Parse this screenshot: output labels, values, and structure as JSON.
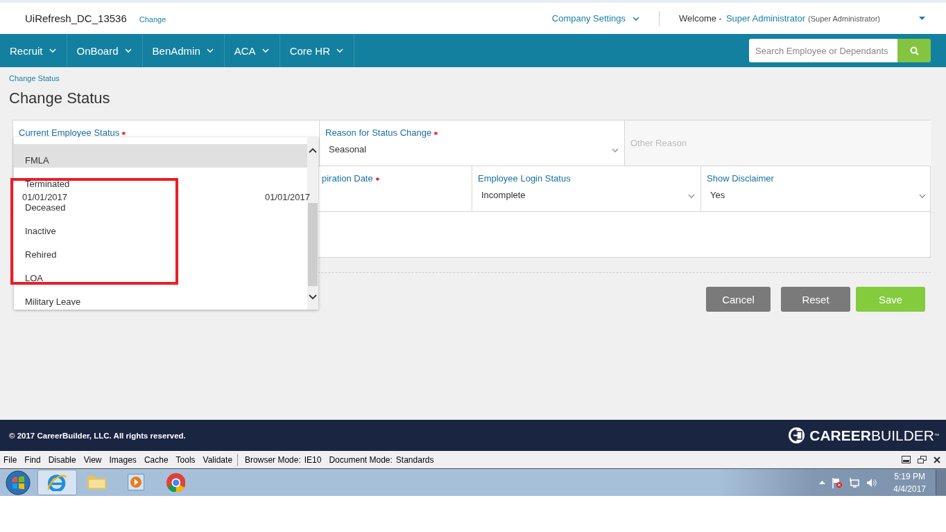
{
  "header": {
    "site": "UiRefresh_DC_13536",
    "change_link": "Change",
    "company_settings": "Company Settings",
    "welcome": "Welcome -",
    "user_name": "Super Administrator",
    "user_role": "(Super Administrator)"
  },
  "nav": {
    "items": [
      {
        "label": "Recruit"
      },
      {
        "label": "OnBoard"
      },
      {
        "label": "BenAdmin"
      },
      {
        "label": "ACA"
      },
      {
        "label": "Core HR"
      }
    ],
    "search": {
      "placeholder": "Search Employee or Dependants"
    }
  },
  "breadcrumb": "Change Status",
  "page_title": "Change Status",
  "form": {
    "lines": [
      {
        "fields": [
          {
            "kind": "select",
            "label": "Current Employee Status",
            "required": true,
            "expanded": true,
            "options": [
              {
                "label": "FMLA",
                "selected": true
              },
              {
                "label": "Terminated",
                "selected": false
              },
              {
                "label": "Deceased",
                "selected": false
              },
              {
                "label": "Inactive",
                "selected": false
              },
              {
                "label": "Rehired",
                "selected": false
              },
              {
                "label": "LOA",
                "selected": false
              },
              {
                "label": "Military Leave",
                "selected": false
              }
            ]
          },
          {
            "kind": "select",
            "label": "Reason for Status Change",
            "required": true,
            "value": "Seasonal"
          },
          {
            "kind": "text",
            "placeholder": "Other Reason",
            "disabled": true
          }
        ]
      },
      {
        "fields": [
          {
            "kind": "date",
            "value": "01/01/2017"
          },
          {
            "kind": "date",
            "value": "01/01/2017"
          },
          {
            "kind": "date",
            "label": "piration Date",
            "required": true
          },
          {
            "kind": "select",
            "label": "Employee Login Status",
            "value": "Incomplete"
          },
          {
            "kind": "select",
            "label": "Show Disclaimer",
            "value": "Yes"
          }
        ]
      },
      {
        "fields": [
          {
            "kind": "textarea"
          }
        ]
      }
    ]
  },
  "buttons": [
    {
      "label": "Cancel",
      "kind": "secondary"
    },
    {
      "label": "Reset",
      "kind": "secondary"
    },
    {
      "label": "Save",
      "kind": "primary"
    }
  ],
  "footer": {
    "copyright": "© 2017 CareerBuilder, LLC. All rights reserved.",
    "logo": "**CAREER**BUILDER$^{™}$"
  },
  "ie_toolbar": {
    "menu": [
      "File",
      "Find",
      "Disable",
      "View",
      "Images",
      "Cache",
      "Tools",
      "Validate"
    ],
    "browser_mode": {
      "label": "Browser Mode:",
      "value": "IE10"
    },
    "document_mode": {
      "label": "Document Mode:",
      "value": "Standards"
    }
  },
  "taskbar": {
    "apps": [
      {
        "kind": "ie",
        "selected": true
      },
      {
        "kind": "folder",
        "selected": false
      },
      {
        "kind": "media",
        "selected": false
      },
      {
        "kind": "chrome",
        "selected": false
      }
    ],
    "clock": {
      "time": "5:19 PM",
      "date": "4/4/2017"
    }
  }
}
